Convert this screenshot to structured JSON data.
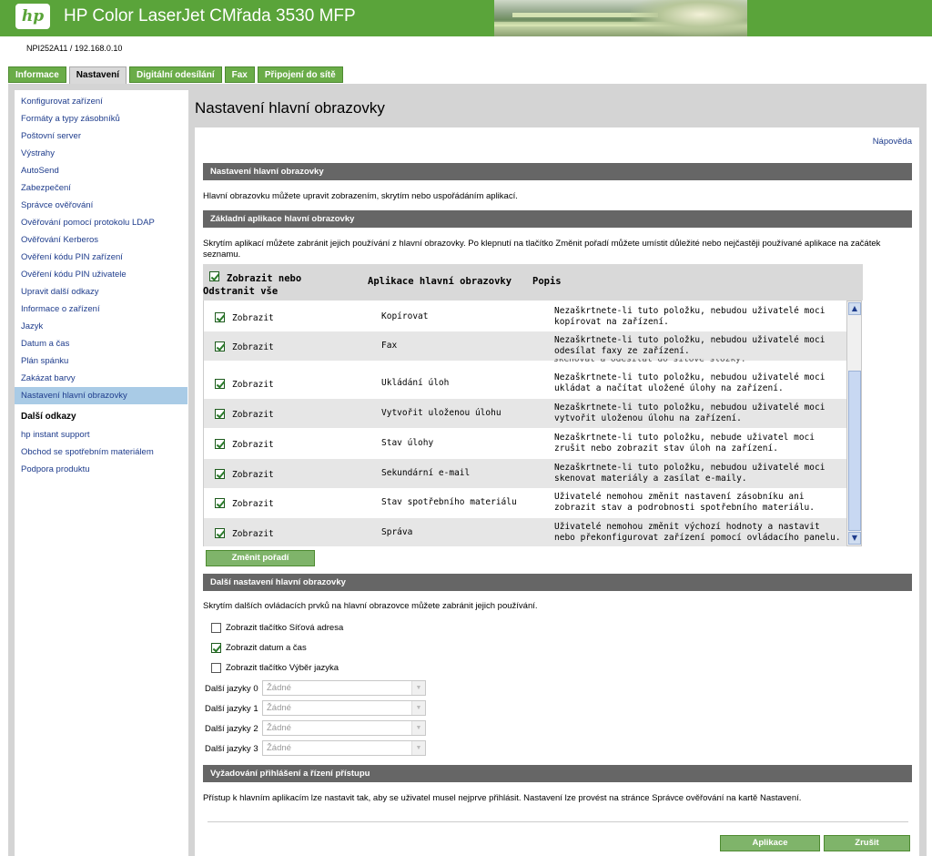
{
  "header": {
    "logo_text": "hp",
    "title": "HP Color LaserJet CMřada 3530 MFP",
    "device": "NPI252A11 / 192.168.0.10",
    "accent": "#5aa43a"
  },
  "tabs": [
    {
      "label": "Informace"
    },
    {
      "label": "Nastavení"
    },
    {
      "label": "Digitální odesílání"
    },
    {
      "label": "Fax"
    },
    {
      "label": "Připojení do sítě"
    }
  ],
  "sidebar": {
    "items": [
      "Konfigurovat zařízení",
      "Formáty a typy zásobníků",
      "Poštovní server",
      "Výstrahy",
      "AutoSend",
      "Zabezpečení",
      "Správce ověřování",
      "Ověřování pomocí protokolu LDAP",
      "Ověřování Kerberos",
      "Ověření kódu PIN zařízení",
      "Ověření kódu PIN uživatele",
      "Upravit další odkazy",
      "Informace o zařízení",
      "Jazyk",
      "Datum a čas",
      "Plán spánku",
      "Zakázat barvy",
      "Nastavení hlavní obrazovky"
    ],
    "other_heading": "Další odkazy",
    "other_links": [
      "hp instant support",
      "Obchod se spotřebním materiálem",
      "Podpora produktu"
    ]
  },
  "main": {
    "title": "Nastavení hlavní obrazovky",
    "help": "Nápověda",
    "sec1_title": "Nastavení hlavní obrazovky",
    "sec1_text": "Hlavní obrazovku můžete upravit zobrazením, skrytím nebo uspořádáním aplikací.",
    "sec2_title": "Základní aplikace hlavní obrazovky",
    "sec2_text": "Skrytím aplikací můžete zabránit jejich používání z hlavní obrazovky. Po klepnutí na tlačítko Změnit pořadí můžete umístit důležité nebo nejčastěji používané aplikace na začátek seznamu.",
    "col_show": "Zobrazit nebo Odstranit vše",
    "col_app": "Aplikace hlavní obrazovky",
    "col_desc": "Popis",
    "ghost_text": "skenovat a odesílat do síťové složky.",
    "rows": [
      {
        "show": "Zobrazit",
        "app": "Kopírovat",
        "desc": "Nezaškrtnete-li tuto položku, nebudou uživatelé moci kopírovat na zařízení."
      },
      {
        "show": "Zobrazit",
        "app": "Fax",
        "desc": "Nezaškrtnete-li tuto položku, nebudou uživatelé moci odesílat faxy ze zařízení."
      },
      {
        "show": "Zobrazit",
        "app": "Ukládání úloh",
        "desc": "Nezaškrtnete-li tuto položku, nebudou uživatelé moci ukládat a načítat uložené úlohy na zařízení."
      },
      {
        "show": "Zobrazit",
        "app": "Vytvořit uloženou úlohu",
        "desc": "Nezaškrtnete-li tuto položku, nebudou uživatelé moci vytvořit uloženou úlohu na zařízení."
      },
      {
        "show": "Zobrazit",
        "app": "Stav úlohy",
        "desc": "Nezaškrtnete-li tuto položku, nebude uživatel moci zrušit nebo zobrazit stav úloh na zařízení."
      },
      {
        "show": "Zobrazit",
        "app": "Sekundární e-mail",
        "desc": "Nezaškrtnete-li tuto položku, nebudou uživatelé moci skenovat materiály a zasílat e-maily."
      },
      {
        "show": "Zobrazit",
        "app": "Stav spotřebního materiálu",
        "desc": "Uživatelé nemohou změnit nastavení zásobníku ani zobrazit stav a podrobnosti spotřebního materiálu."
      },
      {
        "show": "Zobrazit",
        "app": "Správa",
        "desc": "Uživatelé nemohou změnit výchozí hodnoty a nastavit nebo překonfigurovat zařízení pomocí ovládacího panelu."
      }
    ],
    "reorder_button": "Změnit pořadí",
    "sec3_title": "Další nastavení hlavní obrazovky",
    "sec3_text": "Skrytím dalších ovládacích prvků na hlavní obrazovce můžete zabránit jejich používání.",
    "options": [
      {
        "label": "Zobrazit tlačítko Síťová adresa",
        "checked": false
      },
      {
        "label": "Zobrazit datum a čas",
        "checked": true
      },
      {
        "label": "Zobrazit tlačítko Výběr jazyka",
        "checked": false
      }
    ],
    "languages": [
      {
        "label": "Další jazyky 0",
        "value": "Žádné"
      },
      {
        "label": "Další jazyky 1",
        "value": "Žádné"
      },
      {
        "label": "Další jazyky 2",
        "value": "Žádné"
      },
      {
        "label": "Další jazyky 3",
        "value": "Žádné"
      }
    ],
    "sec4_title": "Vyžadování přihlášení a řízení přístupu",
    "sec4_text": "Přístup k hlavním aplikacím lze nastavit tak, aby se uživatel musel nejprve přihlásit. Nastavení lze provést na stránce Správce ověřování na kartě Nastavení.",
    "apply_button": "Aplikace",
    "cancel_button": "Zrušit"
  }
}
